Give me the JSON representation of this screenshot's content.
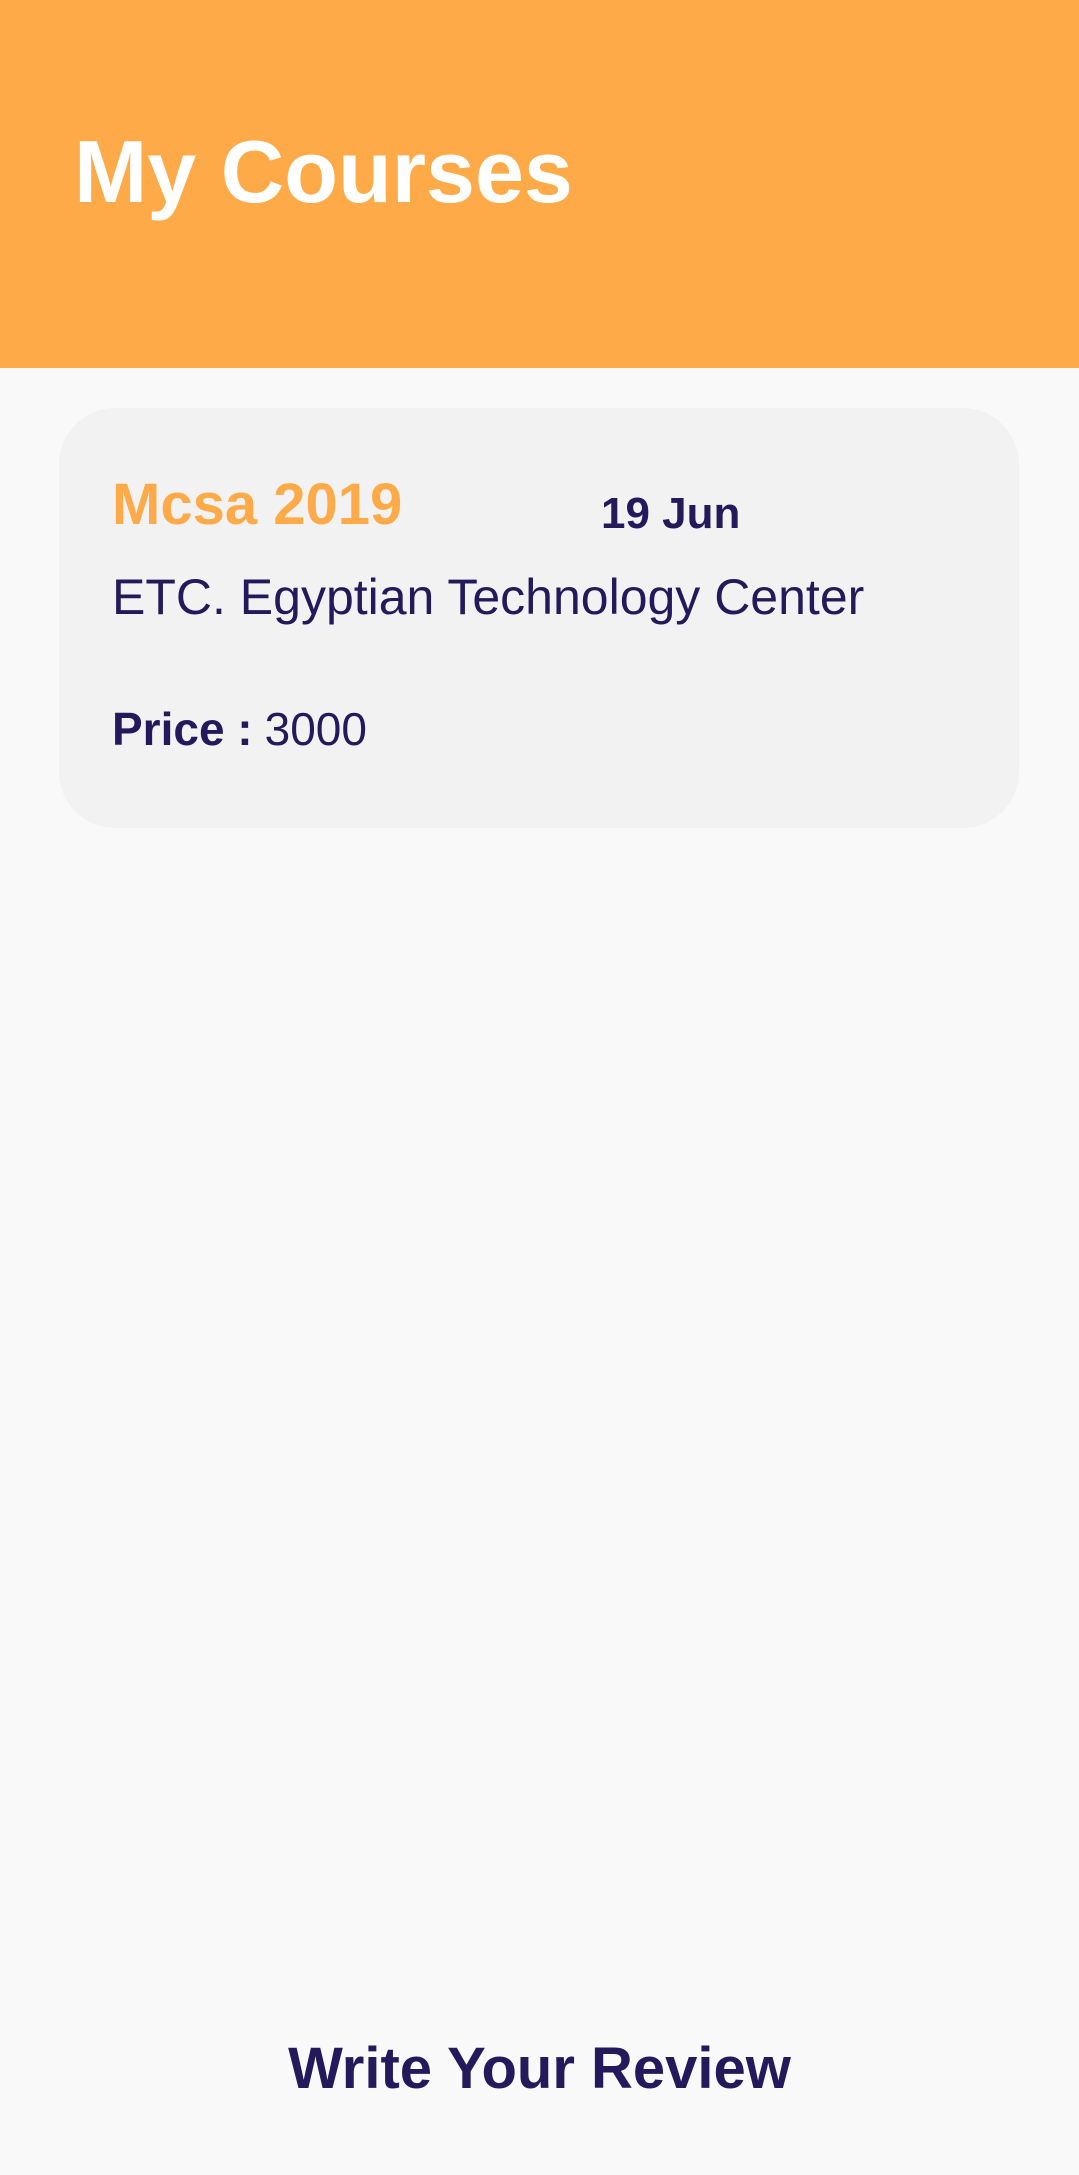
{
  "header": {
    "title": "My Courses",
    "background_color": "#ffaa48"
  },
  "courses": [
    {
      "title": "Mcsa 2019",
      "date": "19 Jun",
      "center": "ETC. Egyptian Technology Center",
      "price_label": "Price :",
      "price_value": "3000"
    }
  ],
  "footer": {
    "review_button_label": "Write Your Review"
  },
  "colors": {
    "accent": "#ffaa48",
    "text_dark": "#24195a",
    "card_background": "#f2f2f2",
    "page_background": "#f9f9f9"
  }
}
